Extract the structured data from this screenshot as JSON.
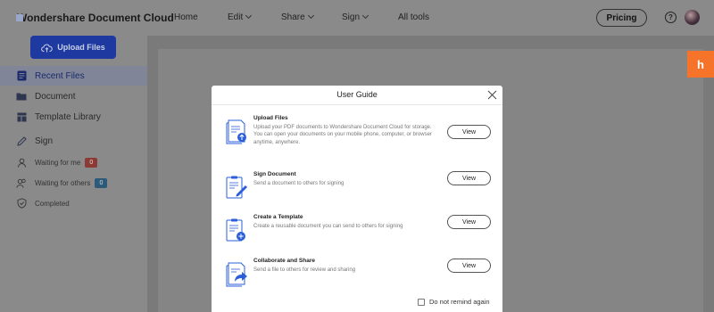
{
  "app": {
    "title": "Wondershare Document Cloud"
  },
  "nav": {
    "home": "Home",
    "edit": "Edit",
    "share": "Share",
    "sign": "Sign",
    "all_tools": "All tools",
    "pricing": "Pricing",
    "help": "?"
  },
  "sidebar": {
    "upload_label": "Upload Files",
    "items": [
      {
        "label": "Recent Files",
        "icon": "recent-files-icon"
      },
      {
        "label": "Document",
        "icon": "folder-icon"
      },
      {
        "label": "Template Library",
        "icon": "template-icon"
      },
      {
        "label": "Sign",
        "icon": "pen-icon"
      },
      {
        "label": "Waiting for me",
        "icon": "user-icon",
        "badge": "0",
        "badge_color": "#c0392b"
      },
      {
        "label": "Waiting for others",
        "icon": "users-icon",
        "badge": "0",
        "badge_color": "#2e7bb5"
      },
      {
        "label": "Completed",
        "icon": "shield-check-icon"
      }
    ]
  },
  "fab": {
    "label": "h"
  },
  "modal": {
    "title": "User Guide",
    "items": [
      {
        "title": "Upload Files",
        "description": "Upload your PDF documents to Wondershare Document Cloud for storage. You can open your documents on your mobile phone, computer, or browser anytime, anywhere.",
        "button": "View"
      },
      {
        "title": "Sign Document",
        "description": "Send a document to others for signing",
        "button": "View"
      },
      {
        "title": "Create a Template",
        "description": "Create a reusable document you can send to others for signing",
        "button": "View"
      },
      {
        "title": "Collaborate and Share",
        "description": "Send a file to others for review and sharing",
        "button": "View"
      }
    ],
    "remind_label": "Do not remind again"
  },
  "colors": {
    "brand_blue": "#1e3aa0",
    "accent_orange": "#f5742a",
    "icon_blue": "#2b5fd9"
  }
}
